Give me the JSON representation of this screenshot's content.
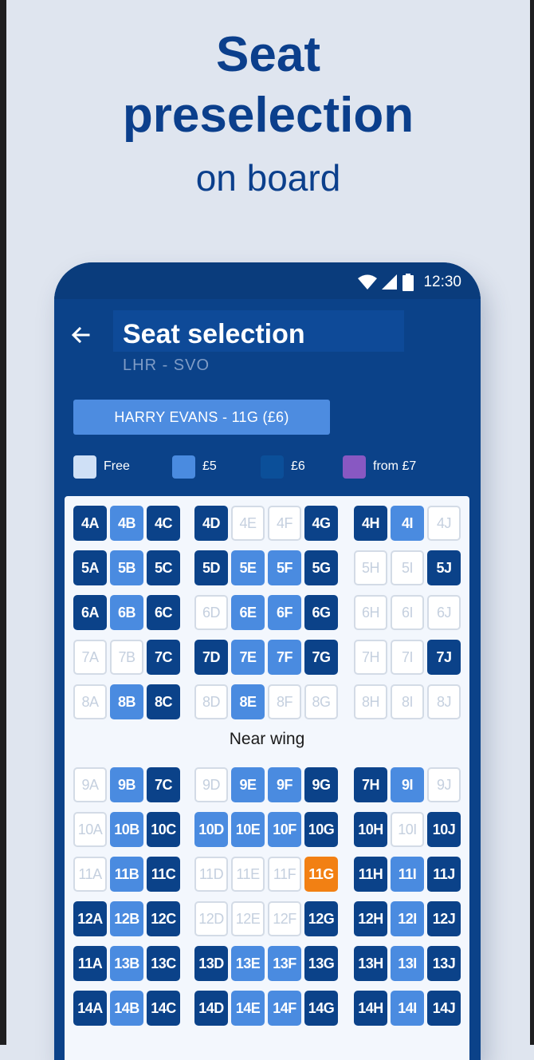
{
  "promo": {
    "line1": "Seat",
    "line2": "preselection",
    "line3": "on board"
  },
  "status_bar": {
    "time": "12:30",
    "icons": [
      "wifi-icon",
      "signal-icon",
      "battery-icon"
    ]
  },
  "header": {
    "title": "Seat selection",
    "route": "LHR - SVO",
    "back_icon": "arrow-left-icon"
  },
  "passenger": {
    "label": "HARRY EVANS - 11G (£6)"
  },
  "legend": [
    {
      "label": "Free",
      "color": "#cfe0f6"
    },
    {
      "label": "£5",
      "color": "#4a8be0"
    },
    {
      "label": "£6",
      "color": "#0b4f99"
    },
    {
      "label": "from £7",
      "color": "#8858c2"
    }
  ],
  "colors": {
    "price_6": "#0b4289",
    "price_5": "#4a8be0",
    "selected": "#f28013",
    "taken_border": "#d3dbe6",
    "header_bg": "#0b4289"
  },
  "zone_label": "Near wing",
  "seat_rows": [
    [
      {
        "id": "4A",
        "s": "p6"
      },
      {
        "id": "4B",
        "s": "p5"
      },
      {
        "id": "4C",
        "s": "p6"
      },
      {
        "id": "4D",
        "s": "p6"
      },
      {
        "id": "4E",
        "s": "taken"
      },
      {
        "id": "4F",
        "s": "taken"
      },
      {
        "id": "4G",
        "s": "p6"
      },
      {
        "id": "4H",
        "s": "p6"
      },
      {
        "id": "4I",
        "s": "p5"
      },
      {
        "id": "4J",
        "s": "taken"
      }
    ],
    [
      {
        "id": "5A",
        "s": "p6"
      },
      {
        "id": "5B",
        "s": "p5"
      },
      {
        "id": "5C",
        "s": "p6"
      },
      {
        "id": "5D",
        "s": "p6"
      },
      {
        "id": "5E",
        "s": "p5"
      },
      {
        "id": "5F",
        "s": "p5"
      },
      {
        "id": "5G",
        "s": "p6"
      },
      {
        "id": "5H",
        "s": "taken"
      },
      {
        "id": "5I",
        "s": "taken"
      },
      {
        "id": "5J",
        "s": "p6"
      }
    ],
    [
      {
        "id": "6A",
        "s": "p6"
      },
      {
        "id": "6B",
        "s": "p5"
      },
      {
        "id": "6C",
        "s": "p6"
      },
      {
        "id": "6D",
        "s": "taken"
      },
      {
        "id": "6E",
        "s": "p5"
      },
      {
        "id": "6F",
        "s": "p5"
      },
      {
        "id": "6G",
        "s": "p6"
      },
      {
        "id": "6H",
        "s": "taken"
      },
      {
        "id": "6I",
        "s": "taken"
      },
      {
        "id": "6J",
        "s": "taken"
      }
    ],
    [
      {
        "id": "7A",
        "s": "taken"
      },
      {
        "id": "7B",
        "s": "taken"
      },
      {
        "id": "7C",
        "s": "p6"
      },
      {
        "id": "7D",
        "s": "p6"
      },
      {
        "id": "7E",
        "s": "p5"
      },
      {
        "id": "7F",
        "s": "p5"
      },
      {
        "id": "7G",
        "s": "p6"
      },
      {
        "id": "7H",
        "s": "taken"
      },
      {
        "id": "7I",
        "s": "taken"
      },
      {
        "id": "7J",
        "s": "p6"
      }
    ],
    [
      {
        "id": "8A",
        "s": "taken"
      },
      {
        "id": "8B",
        "s": "p5"
      },
      {
        "id": "8C",
        "s": "p6"
      },
      {
        "id": "8D",
        "s": "taken"
      },
      {
        "id": "8E",
        "s": "p5"
      },
      {
        "id": "8F",
        "s": "taken"
      },
      {
        "id": "8G",
        "s": "taken"
      },
      {
        "id": "8H",
        "s": "taken"
      },
      {
        "id": "8I",
        "s": "taken"
      },
      {
        "id": "8J",
        "s": "taken"
      }
    ],
    [
      {
        "id": "9A",
        "s": "taken"
      },
      {
        "id": "9B",
        "s": "p5"
      },
      {
        "id": "7C",
        "s": "p6"
      },
      {
        "id": "9D",
        "s": "taken"
      },
      {
        "id": "9E",
        "s": "p5"
      },
      {
        "id": "9F",
        "s": "p5"
      },
      {
        "id": "9G",
        "s": "p6"
      },
      {
        "id": "7H",
        "s": "p6"
      },
      {
        "id": "9I",
        "s": "p5"
      },
      {
        "id": "9J",
        "s": "taken"
      }
    ],
    [
      {
        "id": "10A",
        "s": "taken"
      },
      {
        "id": "10B",
        "s": "p5"
      },
      {
        "id": "10C",
        "s": "p6"
      },
      {
        "id": "10D",
        "s": "p5"
      },
      {
        "id": "10E",
        "s": "p5"
      },
      {
        "id": "10F",
        "s": "p5"
      },
      {
        "id": "10G",
        "s": "p6"
      },
      {
        "id": "10H",
        "s": "p6"
      },
      {
        "id": "10I",
        "s": "taken"
      },
      {
        "id": "10J",
        "s": "p6"
      }
    ],
    [
      {
        "id": "11A",
        "s": "taken"
      },
      {
        "id": "11B",
        "s": "p5"
      },
      {
        "id": "11C",
        "s": "p6"
      },
      {
        "id": "11D",
        "s": "taken"
      },
      {
        "id": "11E",
        "s": "taken"
      },
      {
        "id": "11F",
        "s": "taken"
      },
      {
        "id": "11G",
        "s": "selected"
      },
      {
        "id": "11H",
        "s": "p6"
      },
      {
        "id": "11I",
        "s": "p5"
      },
      {
        "id": "11J",
        "s": "p6"
      }
    ],
    [
      {
        "id": "12A",
        "s": "p6"
      },
      {
        "id": "12B",
        "s": "p5"
      },
      {
        "id": "12C",
        "s": "p6"
      },
      {
        "id": "12D",
        "s": "taken"
      },
      {
        "id": "12E",
        "s": "taken"
      },
      {
        "id": "12F",
        "s": "taken"
      },
      {
        "id": "12G",
        "s": "p6"
      },
      {
        "id": "12H",
        "s": "p6"
      },
      {
        "id": "12I",
        "s": "p5"
      },
      {
        "id": "12J",
        "s": "p6"
      }
    ],
    [
      {
        "id": "11A",
        "s": "p6"
      },
      {
        "id": "13B",
        "s": "p5"
      },
      {
        "id": "13C",
        "s": "p6"
      },
      {
        "id": "13D",
        "s": "p6"
      },
      {
        "id": "13E",
        "s": "p5"
      },
      {
        "id": "13F",
        "s": "p5"
      },
      {
        "id": "13G",
        "s": "p6"
      },
      {
        "id": "13H",
        "s": "p6"
      },
      {
        "id": "13I",
        "s": "p5"
      },
      {
        "id": "13J",
        "s": "p6"
      }
    ],
    [
      {
        "id": "14A",
        "s": "p6"
      },
      {
        "id": "14B",
        "s": "p5"
      },
      {
        "id": "14C",
        "s": "p6"
      },
      {
        "id": "14D",
        "s": "p6"
      },
      {
        "id": "14E",
        "s": "p5"
      },
      {
        "id": "14F",
        "s": "p5"
      },
      {
        "id": "14G",
        "s": "p6"
      },
      {
        "id": "14H",
        "s": "p6"
      },
      {
        "id": "14I",
        "s": "p5"
      },
      {
        "id": "14J",
        "s": "p6"
      }
    ]
  ]
}
